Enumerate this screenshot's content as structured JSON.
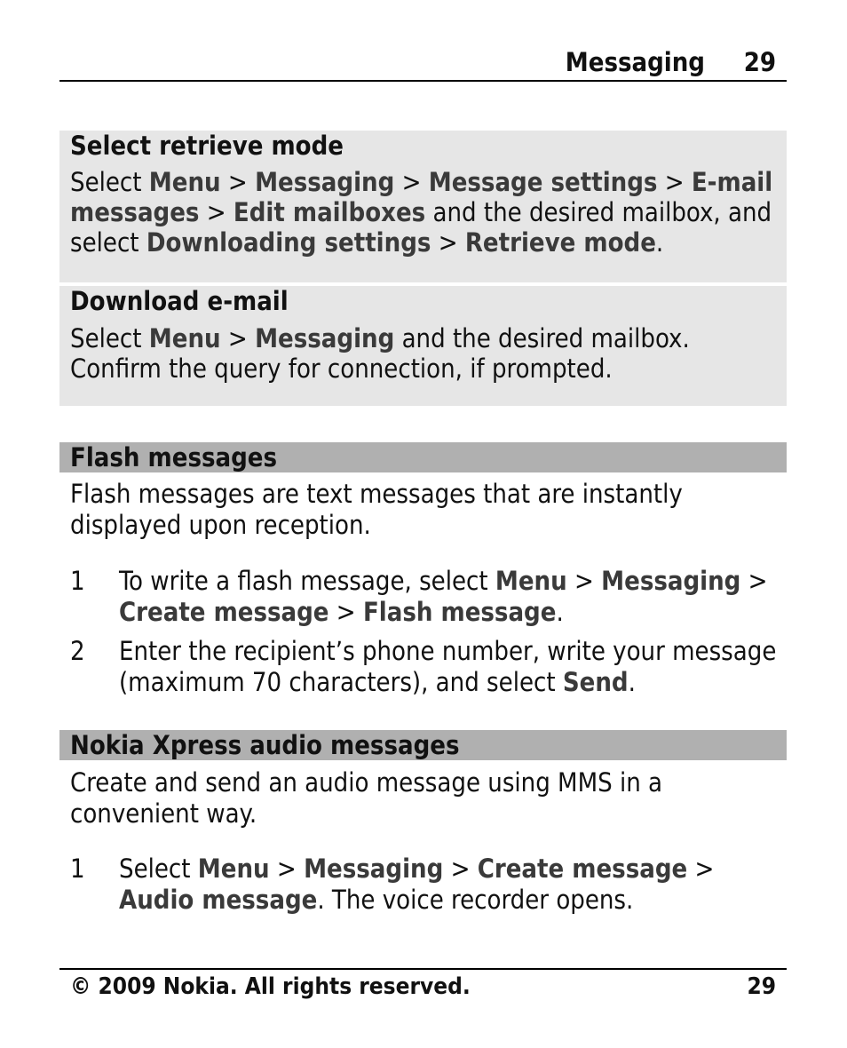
{
  "header": {
    "section_title": "Messaging",
    "page_number": "29"
  },
  "box_retrieve": {
    "title": "Select retrieve mode",
    "parts": [
      {
        "t": "Select ",
        "b": false
      },
      {
        "t": "Menu",
        "b": true
      },
      {
        "t": "  > ",
        "b": false
      },
      {
        "t": "Messaging",
        "b": true
      },
      {
        "t": "  > ",
        "b": false
      },
      {
        "t": "Message settings",
        "b": true
      },
      {
        "t": "  > ",
        "b": false
      },
      {
        "t": "E-mail messages",
        "b": true
      },
      {
        "t": "  > ",
        "b": false
      },
      {
        "t": "Edit mailboxes",
        "b": true
      },
      {
        "t": " and the desired mailbox, and select ",
        "b": false
      },
      {
        "t": "Downloading settings",
        "b": true
      },
      {
        "t": "  > ",
        "b": false
      },
      {
        "t": "Retrieve mode",
        "b": true
      },
      {
        "t": ".",
        "b": false
      }
    ]
  },
  "box_download": {
    "title": "Download e-mail",
    "parts": [
      {
        "t": "Select ",
        "b": false
      },
      {
        "t": "Menu",
        "b": true
      },
      {
        "t": "  > ",
        "b": false
      },
      {
        "t": "Messaging",
        "b": true
      },
      {
        "t": " and the desired mailbox. Confirm the query for connection, if prompted.",
        "b": false
      }
    ]
  },
  "flash": {
    "heading": "Flash messages",
    "intro": "Flash messages are text messages that are instantly displayed upon reception.",
    "steps": [
      {
        "num": "1",
        "parts": [
          {
            "t": "To write a flash message, select ",
            "b": false
          },
          {
            "t": "Menu",
            "b": true
          },
          {
            "t": "  > ",
            "b": false
          },
          {
            "t": "Messaging",
            "b": true
          },
          {
            "t": "  > ",
            "b": false
          },
          {
            "t": "Create message",
            "b": true
          },
          {
            "t": "  > ",
            "b": false
          },
          {
            "t": "Flash message",
            "b": true
          },
          {
            "t": ".",
            "b": false
          }
        ]
      },
      {
        "num": "2",
        "parts": [
          {
            "t": "Enter the recipient’s phone number, write your message (maximum 70 characters), and select ",
            "b": false
          },
          {
            "t": "Send",
            "b": true
          },
          {
            "t": ".",
            "b": false
          }
        ]
      }
    ]
  },
  "xpress": {
    "heading": "Nokia Xpress audio messages",
    "intro": "Create and send an audio message using MMS in a convenient way.",
    "steps": [
      {
        "num": "1",
        "parts": [
          {
            "t": "Select ",
            "b": false
          },
          {
            "t": "Menu",
            "b": true
          },
          {
            "t": "  > ",
            "b": false
          },
          {
            "t": "Messaging",
            "b": true
          },
          {
            "t": "  > ",
            "b": false
          },
          {
            "t": "Create message",
            "b": true
          },
          {
            "t": "  > ",
            "b": false
          },
          {
            "t": "Audio message",
            "b": true
          },
          {
            "t": ". The voice recorder opens.",
            "b": false
          }
        ]
      }
    ]
  },
  "footer": {
    "copyright": "© 2009 Nokia. All rights reserved.",
    "page_number": "29"
  }
}
